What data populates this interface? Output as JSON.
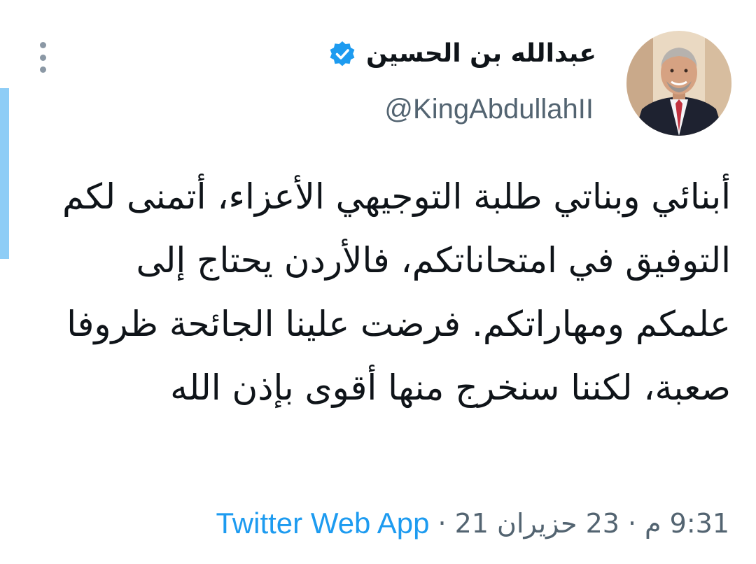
{
  "tweet": {
    "author": {
      "display_name": "عبدالله بن الحسين",
      "handle": "@KingAbdullahII",
      "verified": true,
      "verified_icon": "verified-badge-icon",
      "avatar": "profile-photo"
    },
    "text": "أبنائي وبناتي طلبة التوجيهي الأعزاء، أتمنى لكم التوفيق في امتحاناتكم، فالأردن يحتاج إلى علمكم ومهاراتكم. فرضت علينا الجائحة ظروفا صعبة، لكننا سنخرج منها أقوى بإذن الله",
    "meta": {
      "time": "9:31 م",
      "date": "23 حزيران 21",
      "source": "Twitter Web App",
      "separator": "·"
    },
    "more_menu_icon": "more-vertical-icon"
  },
  "colors": {
    "text_primary": "#0f1419",
    "text_secondary": "#536471",
    "link": "#1d9bf0",
    "verified": "#1d9bf0",
    "accent_bar": "#8ecdf6"
  }
}
